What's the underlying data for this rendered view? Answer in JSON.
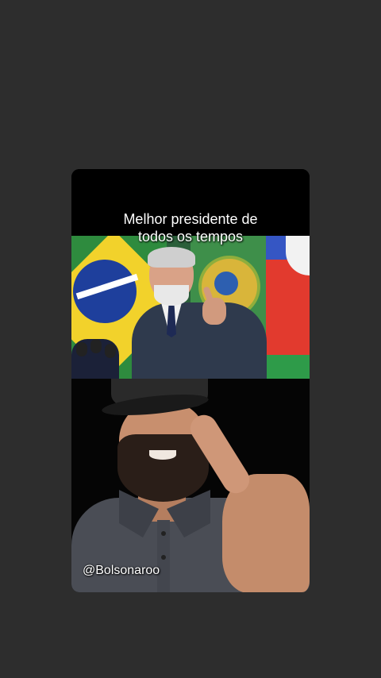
{
  "video": {
    "caption_line1": "Melhor presidente de",
    "caption_line2": "todos os tempos",
    "watermark": "@Bolsonaroo"
  },
  "colors": {
    "page_background": "#2d2d2d",
    "video_background": "#000000",
    "caption_text": "#ffffff"
  }
}
